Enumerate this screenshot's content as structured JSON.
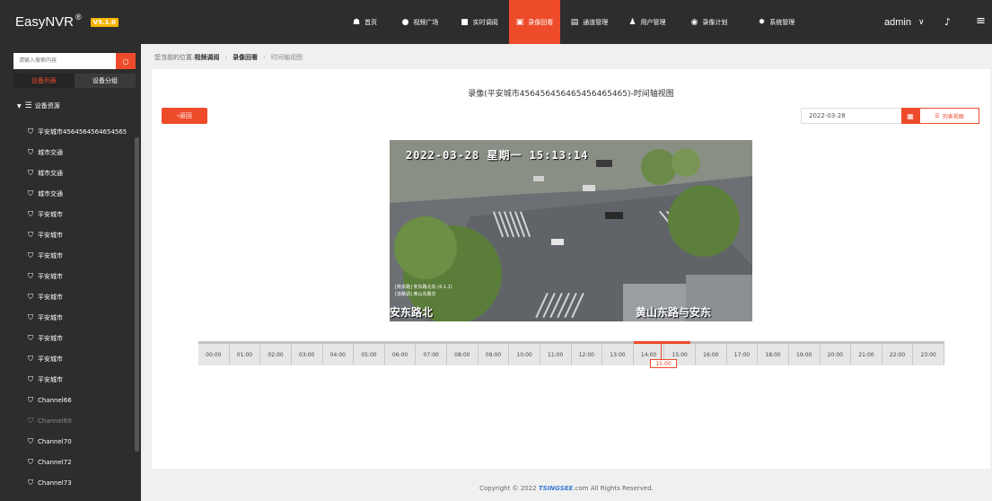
{
  "app": {
    "name": "EasyNVR",
    "reg": "®",
    "version": "V5.1.0"
  },
  "nav": {
    "items": [
      {
        "icon": "☗",
        "label": "首页",
        "name": "nav-home"
      },
      {
        "icon": "●",
        "label": "视频广场",
        "name": "nav-video-square"
      },
      {
        "icon": "■",
        "label": "实时调阅",
        "name": "nav-live"
      },
      {
        "icon": "▣",
        "label": "录像回看",
        "name": "nav-playback"
      },
      {
        "icon": "▤",
        "label": "通道管理",
        "name": "nav-channels"
      },
      {
        "icon": "♟",
        "label": "用户管理",
        "name": "nav-users"
      },
      {
        "icon": "◉",
        "label": "录像计划",
        "name": "nav-record-plan"
      },
      {
        "icon": "✹",
        "label": "系统管理",
        "name": "nav-system"
      }
    ],
    "active_index": 3,
    "user": "admin"
  },
  "sidebar": {
    "search_placeholder": "请输入搜索内容",
    "tabs": [
      "设备列表",
      "设备分组"
    ],
    "active_tab": 0,
    "root_label": "设备资源",
    "items": [
      {
        "label": "平安城市4564564564654565",
        "disabled": false
      },
      {
        "label": "城市交通",
        "disabled": false
      },
      {
        "label": "城市交通",
        "disabled": false
      },
      {
        "label": "城市交通",
        "disabled": false
      },
      {
        "label": "平安城市",
        "disabled": false
      },
      {
        "label": "平安城市",
        "disabled": false
      },
      {
        "label": "平安城市",
        "disabled": false
      },
      {
        "label": "平安城市",
        "disabled": false
      },
      {
        "label": "平安城市",
        "disabled": false
      },
      {
        "label": "平安城市",
        "disabled": false
      },
      {
        "label": "平安城市",
        "disabled": false
      },
      {
        "label": "平安城市",
        "disabled": false
      },
      {
        "label": "平安城市",
        "disabled": false
      },
      {
        "label": "Channel66",
        "disabled": false
      },
      {
        "label": "Channel69",
        "disabled": true
      },
      {
        "label": "Channel70",
        "disabled": false
      },
      {
        "label": "Channel72",
        "disabled": false
      },
      {
        "label": "Channel73",
        "disabled": false
      }
    ]
  },
  "breadcrumb": {
    "prefix": "您当前的位置:",
    "items": [
      "视频调阅",
      "录像回看",
      "时间轴视图"
    ]
  },
  "main": {
    "title": "录像(平安城市456456456465456465465)-时间轴视图",
    "back_label": "返回",
    "date": "2022-03-28",
    "list_view_label": "列表视图"
  },
  "video": {
    "osd_datetime": "2022-03-28 星期一 15:13:14",
    "osd_small_1": "[南京路] 安东路北向 (4.1.1)",
    "osd_small_2": "[道路调] 黄山东路交",
    "osd_left": "安东路北",
    "osd_right": "黄山东路与安东"
  },
  "timeline": {
    "hours": [
      "00:00",
      "01:00",
      "02:00",
      "03:00",
      "04:00",
      "05:00",
      "06:00",
      "07:00",
      "08:00",
      "09:00",
      "10:00",
      "11:00",
      "12:00",
      "13:00",
      "14:00",
      "15:00",
      "16:00",
      "17:00",
      "18:00",
      "19:00",
      "20:00",
      "21:00",
      "22:00",
      "23:00"
    ],
    "current": "15:00"
  },
  "footer": {
    "prefix": "Copyright © 2022 ",
    "brand": "TSINGSEE",
    "suffix": ".com All Rights Reserved."
  },
  "colors": {
    "accent": "#ee4b2b",
    "topbar": "#2d2d2d",
    "version_badge": "#f7b500"
  }
}
